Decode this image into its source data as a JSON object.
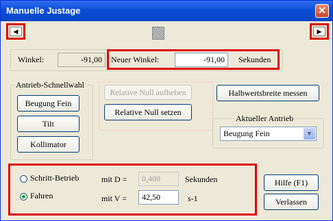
{
  "window": {
    "title": "Manuelle Justage",
    "close_glyph": "✕"
  },
  "nav": {
    "left_glyph": "◀",
    "right_glyph": "▶"
  },
  "angle": {
    "winkel_label": "Winkel:",
    "winkel_value": "-91,00",
    "neuer_label": "Neuer Winkel:",
    "neuer_value": "-91,00",
    "unit": "Sekunden"
  },
  "drive_group": {
    "legend": "Antrieb-Schnellwahl",
    "buttons": [
      "Beugung Fein",
      "Tilt",
      "Kollimator"
    ]
  },
  "relnull": {
    "aufheben": "Relative Null aufheben",
    "setzen": "Relative Null setzen"
  },
  "halbwert_button": "Halbwertsbreite messen",
  "current_drive": {
    "legend": "Aktueller Antrieb",
    "value": "Beugung Fein"
  },
  "mode": {
    "schritt_label": "Schritt-Betrieb",
    "fahren_label": "Fahren",
    "selected": "Fahren",
    "d_label": "mit D =",
    "d_value": "0,400",
    "d_unit": "Sekunden",
    "v_label": "mit V =",
    "v_value": "42,50",
    "v_unit": "s-1"
  },
  "buttons": {
    "help": "Hilfe (F1)",
    "exit": "Verlassen"
  },
  "colors": {
    "highlight": "#e00000",
    "titlebar": "#0a4fd6"
  }
}
